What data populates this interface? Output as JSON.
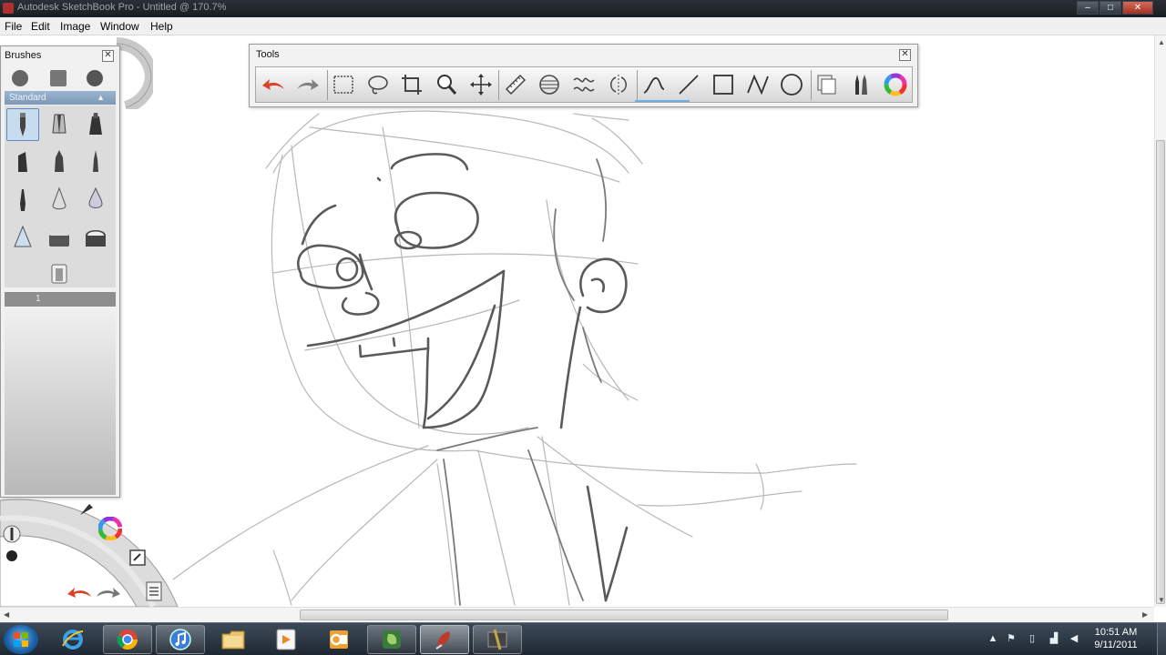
{
  "window": {
    "title": "Autodesk SketchBook Pro - Untitled @ 170.7%",
    "minimize_label": "–",
    "maximize_label": "□",
    "close_label": "✕"
  },
  "menu": [
    "File",
    "Edit",
    "Image",
    "Window",
    "Help"
  ],
  "tools_panel": {
    "title": "Tools",
    "close_label": "✕",
    "tools": [
      "undo",
      "redo",
      "select-rect",
      "lasso",
      "crop",
      "zoom",
      "move",
      "ruler",
      "ellipse-guide",
      "symmetry",
      "mirror",
      "freehand-stroke",
      "line",
      "rectangle",
      "polyline",
      "ellipse",
      "layers",
      "brushes",
      "color-wheel"
    ]
  },
  "brushes_panel": {
    "title": "Brushes",
    "close_label": "✕",
    "set_name": "Standard",
    "layer_number": "1"
  },
  "taskbar": {
    "apps": [
      "internet-explorer",
      "chrome",
      "itunes",
      "file-explorer",
      "media-player",
      "outlook",
      "evernote",
      "sketchbook",
      "paint-tool"
    ],
    "time": "10:51 AM",
    "date": "9/11/2011"
  },
  "colors": {
    "accent_blue": "#6ab0e0",
    "sketch_stroke": "#555555",
    "undo_red": "#d9432c"
  }
}
